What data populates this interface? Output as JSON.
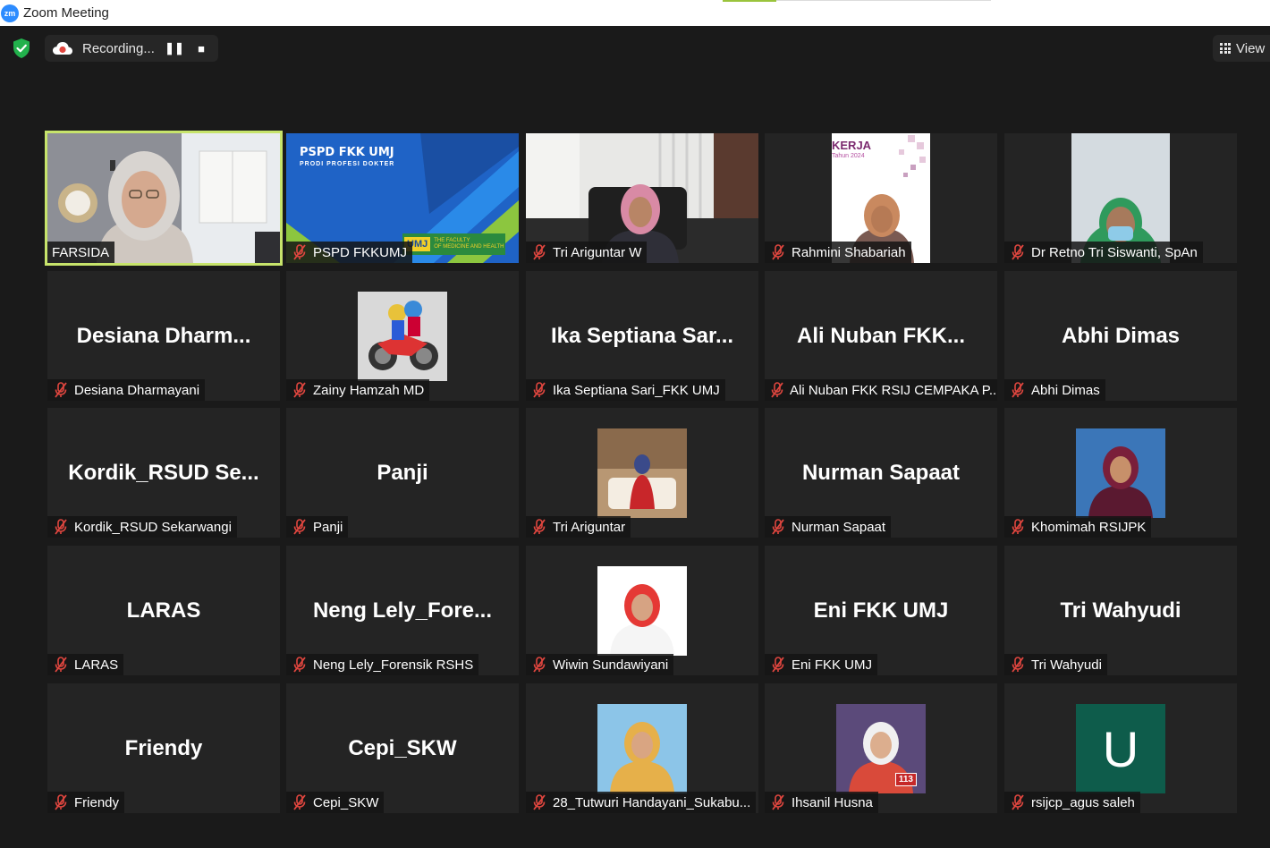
{
  "window": {
    "title": "Zoom Meeting",
    "logo": "zm"
  },
  "toolbar": {
    "recording_label": "Recording...",
    "pause_label": "❚❚",
    "stop_label": "■",
    "view_label": "View"
  },
  "colors": {
    "active_speaker": "#c7e46b",
    "muted_icon": "#e0463f",
    "shield": "#22b14c"
  },
  "participants": [
    {
      "name": "FARSIDA",
      "label": "FARSIDA",
      "video": true,
      "muted": false,
      "active": true
    },
    {
      "name": "PSPD FKKUMJ",
      "label": "PSPD FKKUMJ",
      "video": true,
      "muted": true,
      "banner_title": "PSPD FKK UMJ",
      "banner_sub": "PRODI PROFESI DOKTER",
      "banner_logo": "UMJ",
      "banner_faculty": "THE FACULTY",
      "banner_faculty_sub": "OF MEDICINE AND HEALTH"
    },
    {
      "name": "Tri Ariguntar W",
      "label": "Tri Ariguntar W",
      "video": true,
      "muted": true
    },
    {
      "name": "Rahmini Shabariah",
      "label": "Rahmini Shabariah",
      "video": true,
      "muted": true,
      "poster_title": "KERJA",
      "poster_sub": "Tahun 2024"
    },
    {
      "name": "Dr Retno Tri Siswanti, SpAn",
      "label": "Dr Retno Tri Siswanti, SpAn",
      "video": true,
      "muted": true
    },
    {
      "name": "Desiana  Dharm...",
      "label": "Desiana Dharmayani",
      "video": false,
      "muted": true
    },
    {
      "name": "Zainy Hamzah MD",
      "label": "Zainy Hamzah MD",
      "video": true,
      "muted": true
    },
    {
      "name": "Ika  Septiana  Sar...",
      "label": "Ika Septiana Sari_FKK UMJ",
      "video": false,
      "muted": true
    },
    {
      "name": "Ali  Nuban  FKK...",
      "label": "Ali Nuban FKK RSIJ CEMPAKA P...",
      "video": false,
      "muted": true
    },
    {
      "name": "Abhi Dimas",
      "label": "Abhi Dimas",
      "video": false,
      "muted": true
    },
    {
      "name": "Kordik_RSUD  Se...",
      "label": "Kordik_RSUD Sekarwangi",
      "video": false,
      "muted": true
    },
    {
      "name": "Panji",
      "label": "Panji",
      "video": false,
      "muted": true
    },
    {
      "name": "Tri Ariguntar",
      "label": "Tri Ariguntar",
      "video": true,
      "muted": true
    },
    {
      "name": "Nurman Sapaat",
      "label": "Nurman Sapaat",
      "video": false,
      "muted": true
    },
    {
      "name": "Khomimah RSIJPK",
      "label": "Khomimah RSIJPK",
      "video": true,
      "muted": true
    },
    {
      "name": "LARAS",
      "label": "LARAS",
      "video": false,
      "muted": true
    },
    {
      "name": "Neng  Lely_Fore...",
      "label": "Neng Lely_Forensik RSHS",
      "video": false,
      "muted": true
    },
    {
      "name": "Wiwin Sundawiyani",
      "label": "Wiwin Sundawiyani",
      "video": true,
      "muted": true
    },
    {
      "name": "Eni FKK UMJ",
      "label": "Eni FKK UMJ",
      "video": false,
      "muted": true
    },
    {
      "name": "Tri Wahyudi",
      "label": "Tri Wahyudi",
      "video": false,
      "muted": true
    },
    {
      "name": "Friendy",
      "label": "Friendy",
      "video": false,
      "muted": true
    },
    {
      "name": "Cepi_SKW",
      "label": "Cepi_SKW",
      "video": false,
      "muted": true
    },
    {
      "name": "28_Tutwuri Handayani_Sukabu...",
      "label": "28_Tutwuri Handayani_Sukabu...",
      "video": true,
      "muted": true
    },
    {
      "name": "Ihsanil Husna",
      "label": "Ihsanil Husna",
      "video": true,
      "muted": true,
      "badge": "113"
    },
    {
      "name": "rsijcp_agus saleh",
      "label": "rsijcp_agus saleh",
      "video": true,
      "muted": true,
      "avatar_letter": "U"
    }
  ]
}
